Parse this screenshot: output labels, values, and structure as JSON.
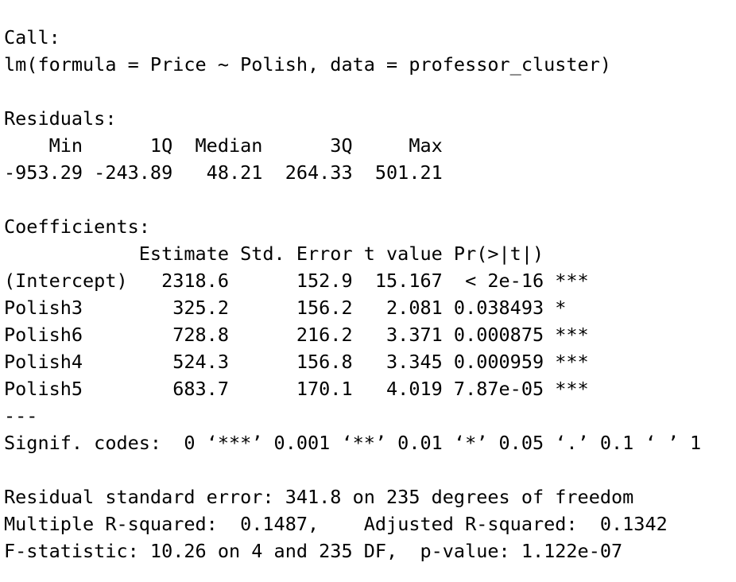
{
  "call": {
    "label": "Call:",
    "formula": "lm(formula = Price ~ Polish, data = professor_cluster)"
  },
  "residuals": {
    "label": "Residuals:",
    "header": "    Min      1Q  Median      3Q     Max ",
    "values": "-953.29 -243.89   48.21  264.33  501.21 "
  },
  "coefficients": {
    "label": "Coefficients:",
    "header": "            Estimate Std. Error t value Pr(>|t|)    ",
    "rows": [
      "(Intercept)   2318.6      152.9  15.167  < 2e-16 ***",
      "Polish3        325.2      156.2   2.081 0.038493 *  ",
      "Polish6        728.8      216.2   3.371 0.000875 ***",
      "Polish4        524.3      156.8   3.345 0.000959 ***",
      "Polish5        683.7      170.1   4.019 7.87e-05 ***"
    ]
  },
  "separator": "---",
  "signif_codes": "Signif. codes:  0 ‘***’ 0.001 ‘**’ 0.01 ‘*’ 0.05 ‘.’ 0.1 ‘ ’ 1",
  "summary": {
    "residual_std_error": "Residual standard error: 341.8 on 235 degrees of freedom",
    "r_squared": "Multiple R-squared:  0.1487,\tAdjusted R-squared:  0.1342 ",
    "f_statistic": "F-statistic: 10.26 on 4 and 235 DF,  p-value: 1.122e-07"
  }
}
